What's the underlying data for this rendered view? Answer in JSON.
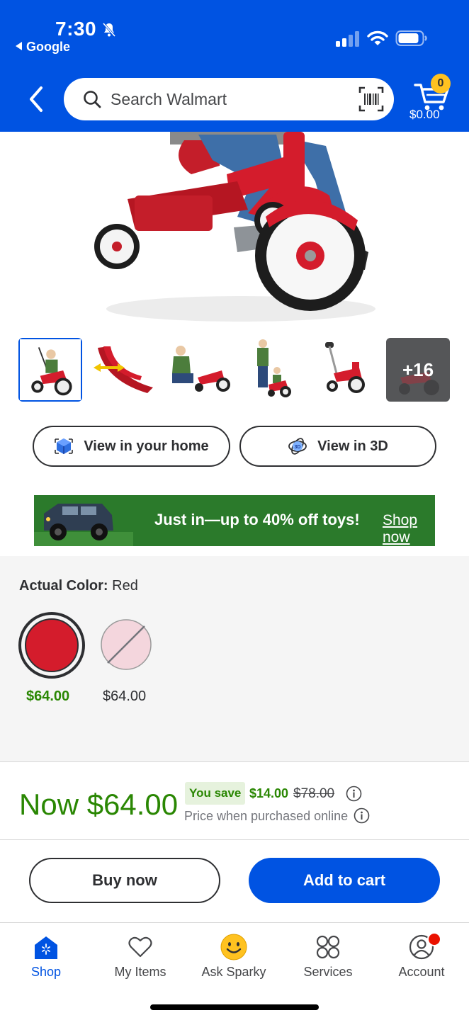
{
  "status_bar": {
    "time": "7:30",
    "back_app": "Google"
  },
  "header": {
    "search_placeholder": "Search Walmart",
    "cart_count": "0",
    "cart_total": "$0.00"
  },
  "thumbnails": {
    "more_label": "+16"
  },
  "actions": {
    "view_home": "View in your home",
    "view_3d": "View in 3D"
  },
  "banner": {
    "text": "Just in—up to 40% off toys!",
    "link": "Shop now"
  },
  "color": {
    "label": "Actual Color:",
    "value": "Red",
    "options": [
      {
        "name": "Red",
        "price": "$64.00",
        "color": "#d41c2c"
      },
      {
        "name": "Pink",
        "price": "$64.00",
        "color": "#f4d6dd"
      }
    ]
  },
  "price": {
    "now": "Now $64.00",
    "you_save_label": "You save",
    "save_amount": "$14.00",
    "was": "$78.00",
    "note": "Price when purchased online"
  },
  "cta": {
    "buy_now": "Buy now",
    "add_to_cart": "Add to cart"
  },
  "tabbar": {
    "items": [
      {
        "label": "Shop"
      },
      {
        "label": "My Items"
      },
      {
        "label": "Ask Sparky"
      },
      {
        "label": "Services"
      },
      {
        "label": "Account"
      }
    ]
  },
  "colors": {
    "brand_blue": "#0053e2",
    "price_green": "#2a8703",
    "spark_yellow": "#ffc220"
  }
}
